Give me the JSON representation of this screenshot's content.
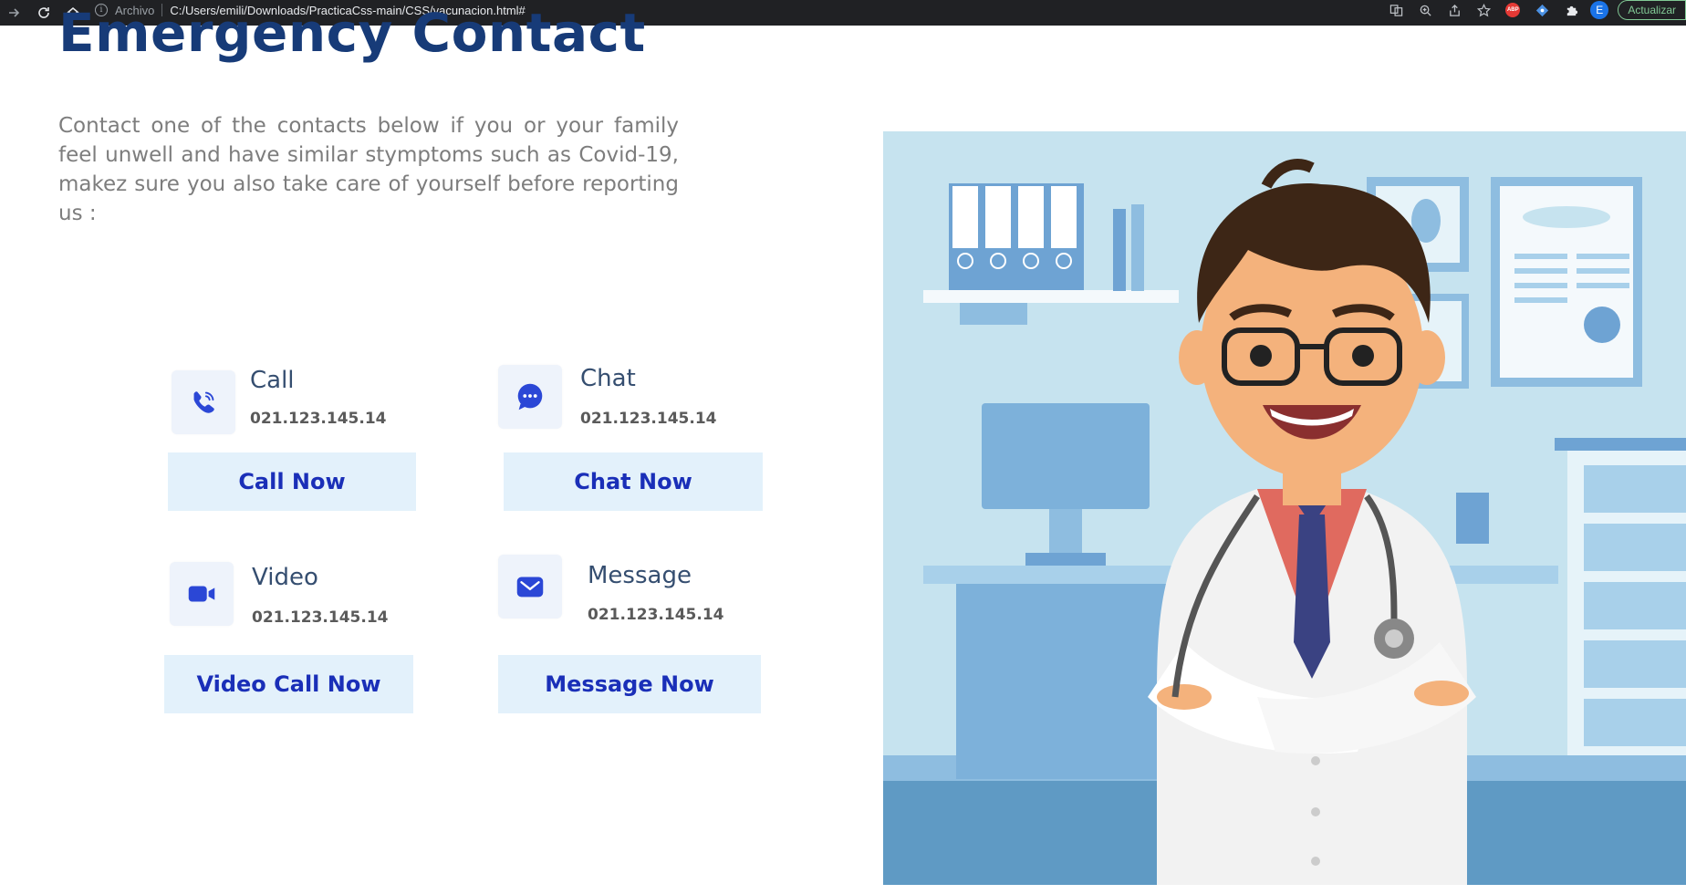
{
  "browser": {
    "info_label": "Archivo",
    "url": "C:/Users/emili/Downloads/PracticaCss-main/CSS/vacunacion.html#",
    "profile_initial": "E",
    "abp_label": "ABP",
    "update_label": "Actualizar"
  },
  "page": {
    "title": "Emergency Contact",
    "description": "Contact one of the contacts below if you or your family feel unwell and have similar stymptoms such as Covid-19, makez sure you also take care of yourself before reporting us :"
  },
  "contacts": [
    {
      "label": "Call",
      "phone": "021.123.145.14",
      "button": "Call Now",
      "icon": "phone-icon"
    },
    {
      "label": "Chat",
      "phone": "021.123.145.14",
      "button": "Chat Now",
      "icon": "chat-bubble-icon"
    },
    {
      "label": "Video",
      "phone": "021.123.145.14",
      "button": "Video Call Now",
      "icon": "video-camera-icon"
    },
    {
      "label": "Message",
      "phone": "021.123.145.14",
      "button": "Message Now",
      "icon": "envelope-icon"
    }
  ],
  "colors": {
    "title": "#173b78",
    "button_bg": "#e3f1fb",
    "button_text": "#1a2fb8",
    "icon_blue": "#2b47d6",
    "illustration_bg": "#c6e3ef"
  }
}
